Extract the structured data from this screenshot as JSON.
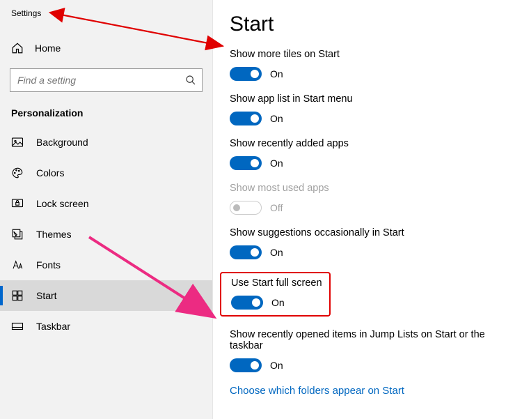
{
  "window_title": "Settings",
  "sidebar": {
    "home_label": "Home",
    "search_placeholder": "Find a setting",
    "section_header": "Personalization",
    "items": [
      {
        "icon": "image-icon",
        "label": "Background",
        "selected": false
      },
      {
        "icon": "palette-icon",
        "label": "Colors",
        "selected": false
      },
      {
        "icon": "lock-icon",
        "label": "Lock screen",
        "selected": false
      },
      {
        "icon": "themes-icon",
        "label": "Themes",
        "selected": false
      },
      {
        "icon": "font-icon",
        "label": "Fonts",
        "selected": false
      },
      {
        "icon": "start-icon",
        "label": "Start",
        "selected": true
      },
      {
        "icon": "taskbar-icon",
        "label": "Taskbar",
        "selected": false
      }
    ]
  },
  "main": {
    "title": "Start",
    "settings": [
      {
        "label": "Show more tiles on Start",
        "state": "on",
        "state_label": "On",
        "disabled": false,
        "highlight": false
      },
      {
        "label": "Show app list in Start menu",
        "state": "on",
        "state_label": "On",
        "disabled": false,
        "highlight": false
      },
      {
        "label": "Show recently added apps",
        "state": "on",
        "state_label": "On",
        "disabled": false,
        "highlight": false
      },
      {
        "label": "Show most used apps",
        "state": "off",
        "state_label": "Off",
        "disabled": true,
        "highlight": false
      },
      {
        "label": "Show suggestions occasionally in Start",
        "state": "on",
        "state_label": "On",
        "disabled": false,
        "highlight": false
      },
      {
        "label": "Use Start full screen",
        "state": "on",
        "state_label": "On",
        "disabled": false,
        "highlight": true
      },
      {
        "label": "Show recently opened items in Jump Lists on Start or the taskbar",
        "state": "on",
        "state_label": "On",
        "disabled": false,
        "highlight": false
      }
    ],
    "link_text": "Choose which folders appear on Start"
  },
  "annotation": {
    "arrow1_color": "#e00000",
    "arrow2_color": "#ec2b82"
  }
}
